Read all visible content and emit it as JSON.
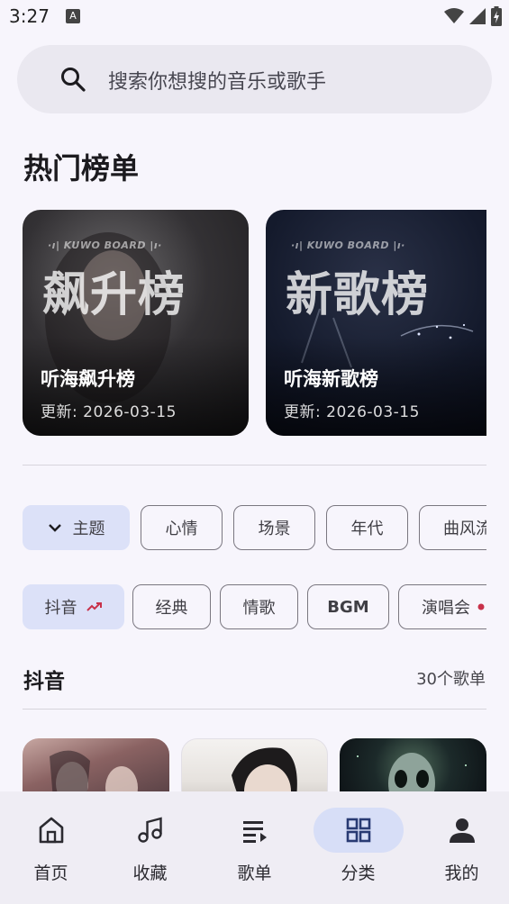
{
  "status_bar": {
    "time": "3:27",
    "badge": "A"
  },
  "search": {
    "placeholder": "搜索你想搜的音乐或歌手"
  },
  "hot_charts": {
    "title": "热门榜单",
    "cards": [
      {
        "board_tag": "·ı| KUWO BOARD |ı·",
        "board_text": "飙升榜",
        "name": "听海飙升榜",
        "updated": "更新: 2026-03-15"
      },
      {
        "board_tag": "·ı| KUWO BOARD |ı·",
        "board_text": "新歌榜",
        "name": "听海新歌榜",
        "updated": "更新: 2026-03-15"
      }
    ]
  },
  "filters": {
    "group_chips": [
      {
        "label": "主题",
        "selected": true
      },
      {
        "label": "心情",
        "selected": false
      },
      {
        "label": "场景",
        "selected": false
      },
      {
        "label": "年代",
        "selected": false
      },
      {
        "label": "曲风流",
        "selected": false
      }
    ],
    "tag_chips": [
      {
        "label": "抖音",
        "selected": true
      },
      {
        "label": "经典",
        "selected": false
      },
      {
        "label": "情歌",
        "selected": false
      },
      {
        "label": "BGM",
        "selected": false
      },
      {
        "label": "演唱会",
        "selected": false
      }
    ]
  },
  "category": {
    "title": "抖音",
    "count": "30个歌单"
  },
  "colors": {
    "accent_chip": "#dce1f8",
    "trend_red": "#c8314a",
    "nav_active": "#d7def7",
    "background": "#f7f5fc"
  },
  "bottom_nav": [
    {
      "label": "首页",
      "icon": "home-icon",
      "active": false
    },
    {
      "label": "收藏",
      "icon": "music-note-icon",
      "active": false
    },
    {
      "label": "歌单",
      "icon": "playlist-icon",
      "active": false
    },
    {
      "label": "分类",
      "icon": "grid-icon",
      "active": true
    },
    {
      "label": "我的",
      "icon": "person-icon",
      "active": false
    }
  ]
}
